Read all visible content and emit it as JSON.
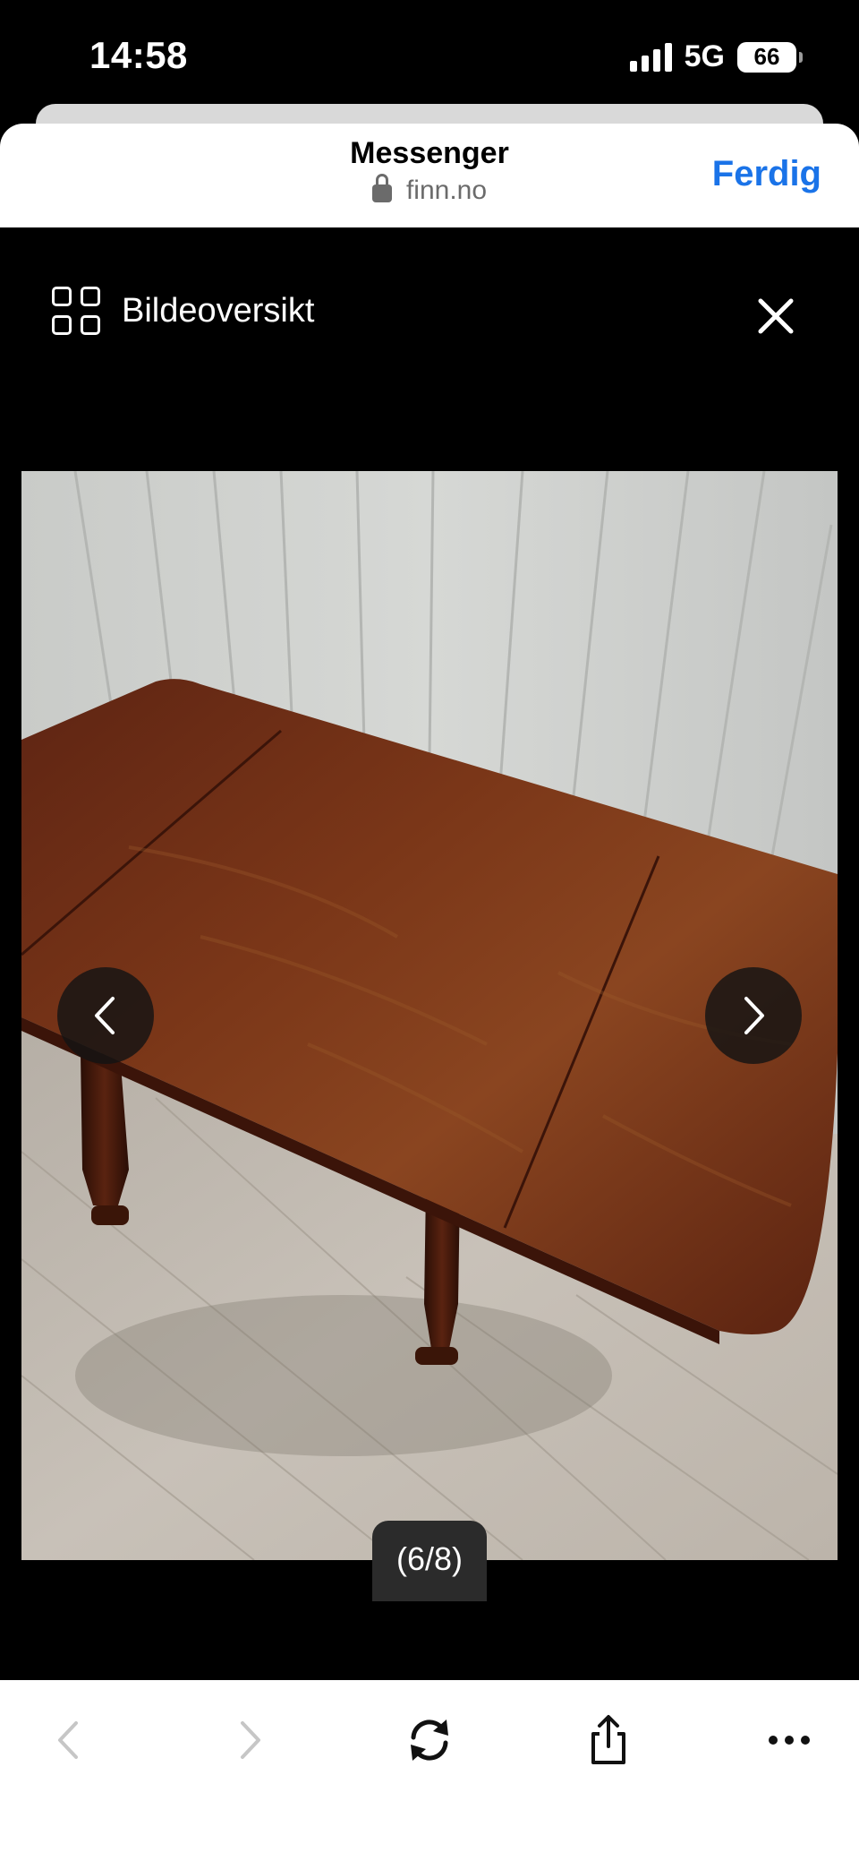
{
  "status_bar": {
    "time": "14:58",
    "network": "5G",
    "battery": "66"
  },
  "browser": {
    "title": "Messenger",
    "url": "finn.no",
    "done_label": "Ferdig",
    "accent_color": "#1a73e8"
  },
  "viewer": {
    "overview_label": "Bildeoversikt",
    "counter": "(6/8)",
    "image_description_icon": "photo"
  },
  "toolbar": {
    "items": [
      {
        "icon": "chevron-left-icon",
        "enabled": false
      },
      {
        "icon": "chevron-right-icon",
        "enabled": false
      },
      {
        "icon": "reload-icon",
        "enabled": true
      },
      {
        "icon": "share-icon",
        "enabled": true
      },
      {
        "icon": "more-icon",
        "enabled": true
      }
    ]
  }
}
